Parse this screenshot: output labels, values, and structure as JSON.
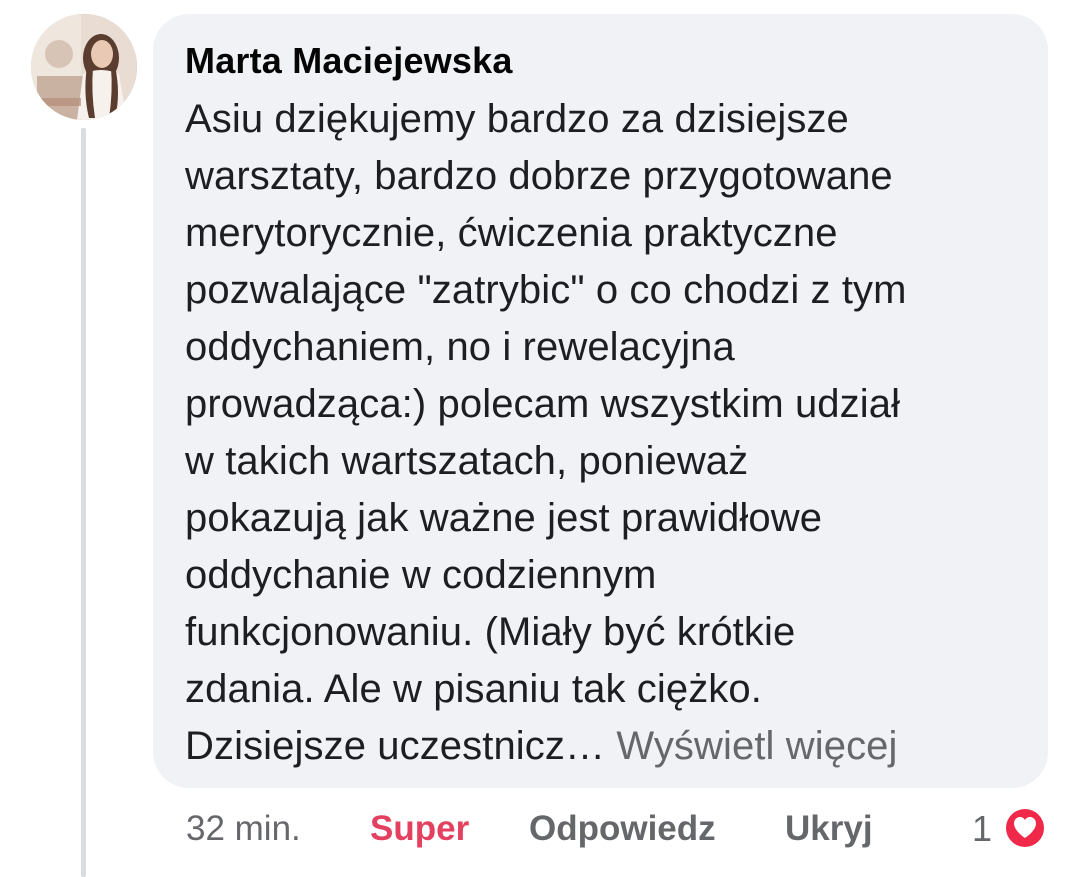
{
  "comment": {
    "author": "Marta Maciejewska",
    "lines": [
      "Asiu dziękujemy bardzo za dzisiejsze",
      "warsztaty, bardzo dobrze przygotowane",
      "merytorycznie, ćwiczenia praktyczne",
      "pozwalające \"zatrybic\" o co chodzi z tym",
      "oddychaniem, no i rewelacyjna",
      "prowadząca:) polecam wszystkim udział",
      "w takich wartszatach, ponieważ",
      "pokazują jak ważne jest prawidłowe",
      "oddychanie w codziennym",
      "funkcjonowaniu. (Miały być krótkie",
      "zdania. Ale w pisaniu tak ciężko.",
      "Dzisiejsze uczestnicz…"
    ],
    "see_more_label": "Wyświetl więcej"
  },
  "actions": {
    "time": "32 min.",
    "react_label": "Super",
    "reply_label": "Odpowiedz",
    "hide_label": "Ukryj"
  },
  "reactions": {
    "count": "1",
    "icon": "heart-icon",
    "color": "#f0284a"
  },
  "colors": {
    "bubble": "#f0f2f5",
    "secondary_text": "#65676b",
    "react_accent": "#e4405f"
  }
}
